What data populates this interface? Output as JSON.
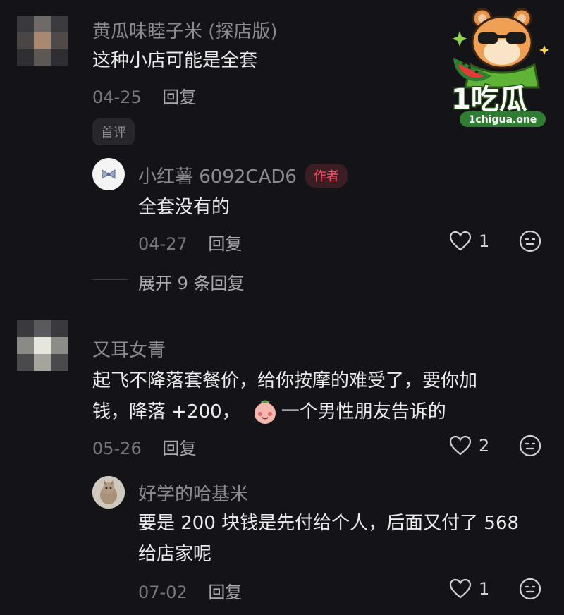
{
  "watermark": {
    "brand": "1吃瓜",
    "url": "1chigua.one"
  },
  "comments": [
    {
      "name": "黄瓜味睦子米 (探店版)",
      "text": [
        "这种小店可能是全套"
      ],
      "date": "04-25",
      "reply_label": "回复",
      "tag": "首评",
      "replies": [
        {
          "name": "小红薯 6092CAD6",
          "badge": "作者",
          "text": [
            "全套没有的"
          ],
          "date": "04-27",
          "reply_label": "回复",
          "likes": "1"
        }
      ],
      "expand_label": "展开 9 条回复"
    },
    {
      "name": "又耳女青",
      "text": [
        "起飞不降落套餐价，给你按摩的难受了，要你加",
        "钱，降落 +200，",
        "一个男性朋友告诉的"
      ],
      "date": "05-26",
      "reply_label": "回复",
      "likes": "2",
      "replies": [
        {
          "name": "好学的哈基米",
          "text": [
            "要是 200 块钱是先付给个人，后面又付了 568",
            "给店家呢"
          ],
          "date": "07-02",
          "reply_label": "回复",
          "likes": "1"
        }
      ]
    }
  ]
}
